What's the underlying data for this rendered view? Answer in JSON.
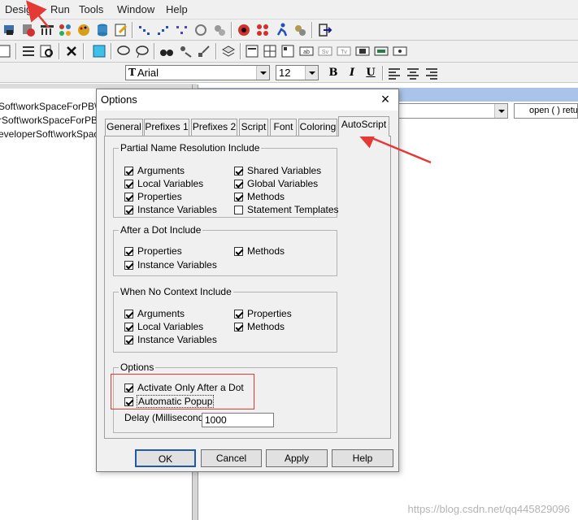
{
  "menu": {
    "items": [
      "Design",
      "Run",
      "Tools",
      "Window",
      "Help"
    ]
  },
  "font_toolbar": {
    "font_name": "Arial",
    "font_size": "12",
    "bold": "B",
    "italic": "I",
    "underline": "U"
  },
  "background": {
    "paths": [
      "Soft\\workSpaceForPB\\PB",
      "rSoft\\workSpaceForPB\\P",
      "eveloperSoft\\workSpaceF"
    ],
    "code_snippet": "open ( )  retu"
  },
  "dialog": {
    "title": "Options",
    "close": "×",
    "tabs": [
      "General",
      "Prefixes 1",
      "Prefixes 2",
      "Script",
      "Font",
      "Coloring",
      "AutoScript"
    ],
    "active_tab": "AutoScript",
    "partial": {
      "title": "Partial Name Resolution Include",
      "left": [
        {
          "label": "Arguments",
          "checked": true
        },
        {
          "label": "Local Variables",
          "checked": true
        },
        {
          "label": "Properties",
          "checked": true
        },
        {
          "label": "Instance Variables",
          "checked": true
        }
      ],
      "right": [
        {
          "label": "Shared Variables",
          "checked": true
        },
        {
          "label": "Global Variables",
          "checked": true
        },
        {
          "label": "Methods",
          "checked": true
        },
        {
          "label": "Statement Templates",
          "checked": false
        }
      ]
    },
    "after_dot": {
      "title": "After a Dot Include",
      "left": [
        {
          "label": "Properties",
          "checked": true
        },
        {
          "label": "Instance Variables",
          "checked": true
        }
      ],
      "right": [
        {
          "label": "Methods",
          "checked": true
        }
      ]
    },
    "no_context": {
      "title": "When No Context Include",
      "left": [
        {
          "label": "Arguments",
          "checked": true
        },
        {
          "label": "Local Variables",
          "checked": true
        },
        {
          "label": "Instance Variables",
          "checked": true
        }
      ],
      "right": [
        {
          "label": "Properties",
          "checked": true
        },
        {
          "label": "Methods",
          "checked": true
        }
      ]
    },
    "options": {
      "title": "Options",
      "activate_after_dot": {
        "label": "Activate Only After a Dot",
        "checked": true
      },
      "automatic_popup": {
        "label": "Automatic Popup",
        "checked": true
      },
      "delay_label": "Delay (Milliseconds):",
      "delay_value": "1000"
    },
    "buttons": {
      "ok": "OK",
      "cancel": "Cancel",
      "apply": "Apply",
      "help": "Help"
    }
  },
  "watermark": "https://blog.csdn.net/qq445829096",
  "colors": {
    "annotation": "#e53935",
    "selection_bar": "#a9c4e8"
  }
}
